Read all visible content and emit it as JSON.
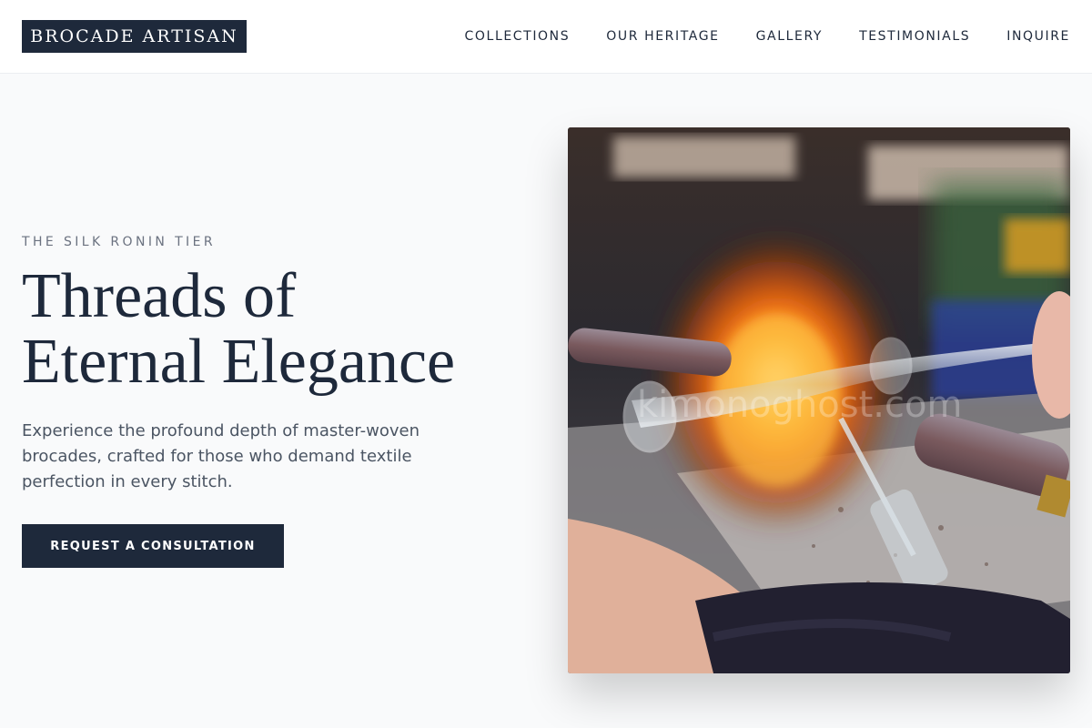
{
  "brand": {
    "name": "BROCADE ARTISAN"
  },
  "nav": {
    "items": [
      "COLLECTIONS",
      "OUR HERITAGE",
      "GALLERY",
      "TESTIMONIALS",
      "INQUIRE"
    ]
  },
  "hero": {
    "eyebrow": "THE SILK RONIN TIER",
    "headline_line1": "Threads of",
    "headline_line2": "Eternal Elegance",
    "description": "Experience the profound depth of master-woven brocades, crafted for those who demand textile perfection in every stitch.",
    "cta_label": "REQUEST A CONSULTATION",
    "image": {
      "subject": "glassblower-shaping-glass-tube-in-flame",
      "watermark": "kimonoghost.com"
    }
  },
  "colors": {
    "primary": "#1e293b",
    "background": "#f9fafb",
    "muted_text": "#6b7280",
    "body_text": "#4b5563"
  }
}
